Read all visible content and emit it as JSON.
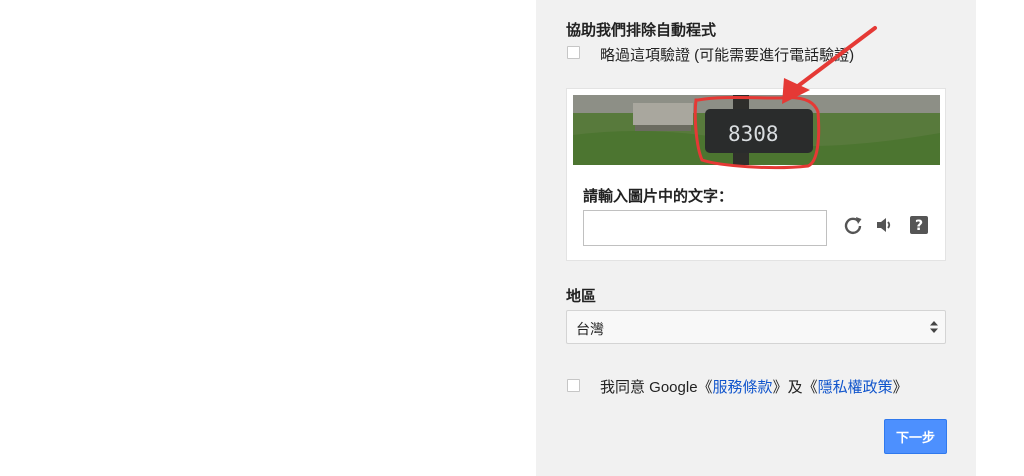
{
  "form": {
    "title": "協助我們排除自動程式",
    "skip_verification_label": "略過這項驗證 (可能需要進行電話驗證)",
    "captcha": {
      "image_text": "8308",
      "prompt": "請輸入圖片中的文字：",
      "input_value": ""
    },
    "region": {
      "label": "地區",
      "selected": "台灣"
    },
    "agreement": {
      "prefix": "我同意 Google《",
      "terms_link": "服務條款",
      "middle": "》及《",
      "privacy_link": "隱私權政策",
      "suffix": "》"
    },
    "next_button": "下一步"
  },
  "colors": {
    "panel_bg": "#f1f1f1",
    "link": "#1155cc",
    "primary_button": "#4d90fe",
    "annotation_red": "#e53935"
  },
  "icons": [
    "reload-icon",
    "audio-icon",
    "help-icon",
    "red-arrow-annotation",
    "red-circle-annotation"
  ]
}
